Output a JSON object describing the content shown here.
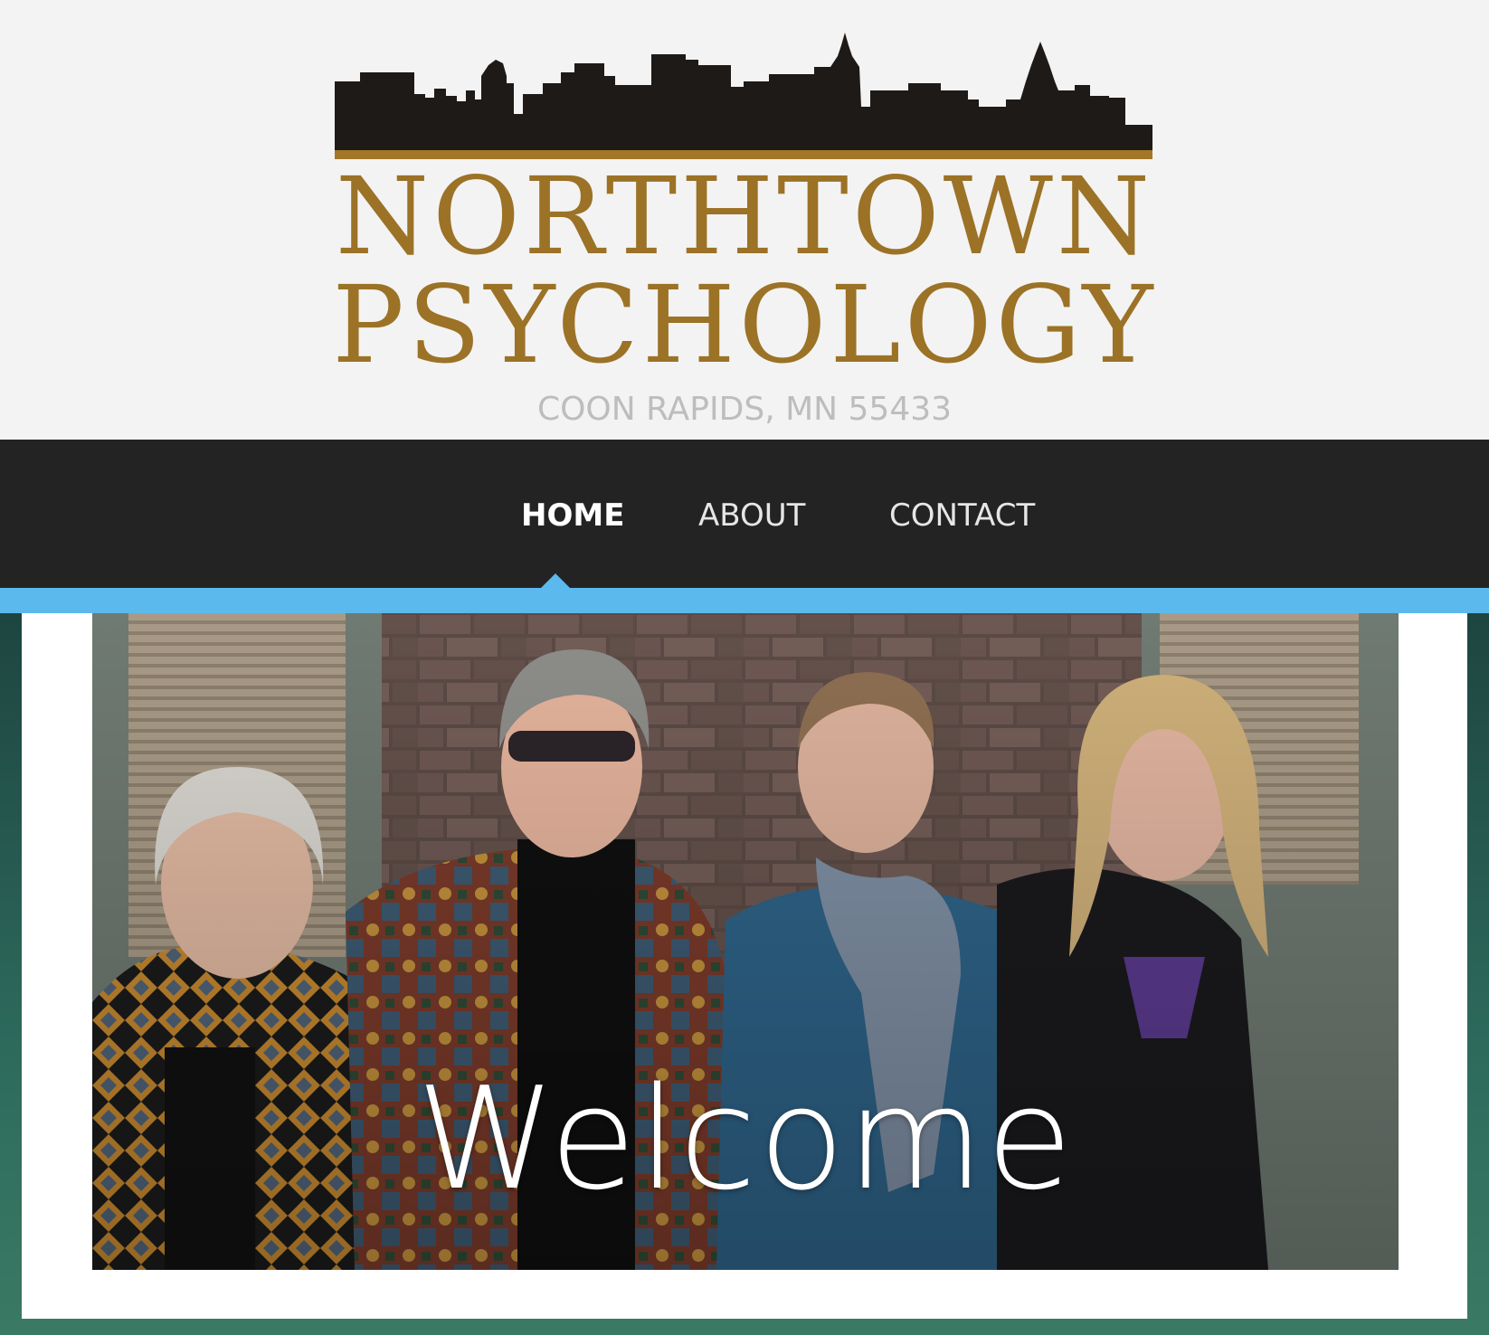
{
  "header": {
    "logo_line1": "NORTHTOWN",
    "logo_line2": "PSYCHOLOGY",
    "location": "COON RAPIDS, MN 55433"
  },
  "nav": {
    "items": [
      {
        "label": "HOME",
        "active": true
      },
      {
        "label": "ABOUT",
        "active": false
      },
      {
        "label": "CONTACT",
        "active": false
      }
    ]
  },
  "hero": {
    "heading": "Welcome"
  },
  "colors": {
    "logo_gold": "#9b7226",
    "skyline": "#1d1a17",
    "nav_background": "#242324",
    "accent_blue": "#5bb9ee"
  }
}
